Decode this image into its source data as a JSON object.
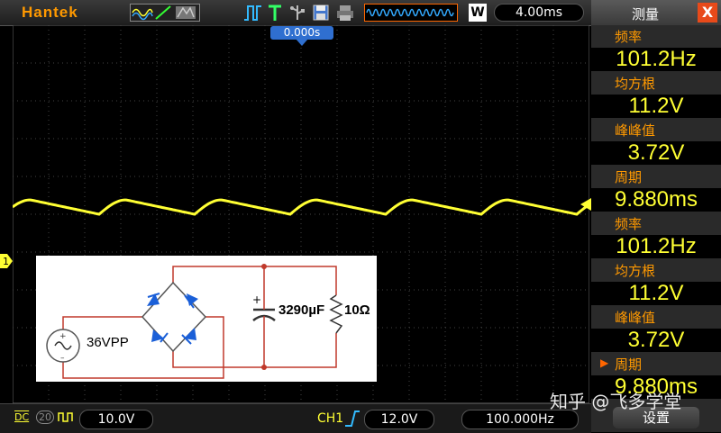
{
  "top_bar": {
    "brand": "Hantek",
    "timebase": "4.00ms",
    "acq_mode": "W"
  },
  "trigger": {
    "time_offset": "0.000s"
  },
  "channel_marker": "1",
  "side_panel": {
    "title": "测量",
    "close": "X",
    "measurements": [
      {
        "label": "频率",
        "value": "101.2Hz"
      },
      {
        "label": "均方根",
        "value": "11.2V"
      },
      {
        "label": "峰峰值",
        "value": "3.72V"
      },
      {
        "label": "周期",
        "value": "9.880ms"
      },
      {
        "label": "频率",
        "value": "101.2Hz"
      },
      {
        "label": "均方根",
        "value": "11.2V"
      },
      {
        "label": "峰峰值",
        "value": "3.72V"
      },
      {
        "label": "周期",
        "value": "9.880ms"
      }
    ],
    "settings": "设置"
  },
  "bottom_bar": {
    "coupling": "DC",
    "bw_limit": "20",
    "volts_div": "10.0V",
    "trigger_channel": "CH1",
    "trigger_level": "12.0V",
    "trigger_freq": "100.000Hz"
  },
  "circuit": {
    "source_label": "36VPP",
    "capacitor_label": "3290µF",
    "resistor_label": "10Ω",
    "plus_sign": "+"
  },
  "watermark": "知乎 @飞多学堂",
  "colors": {
    "trace": "#ffff33",
    "accent": "#ff9900",
    "diode": "#1a5fd8",
    "wire": "#c0392b"
  }
}
